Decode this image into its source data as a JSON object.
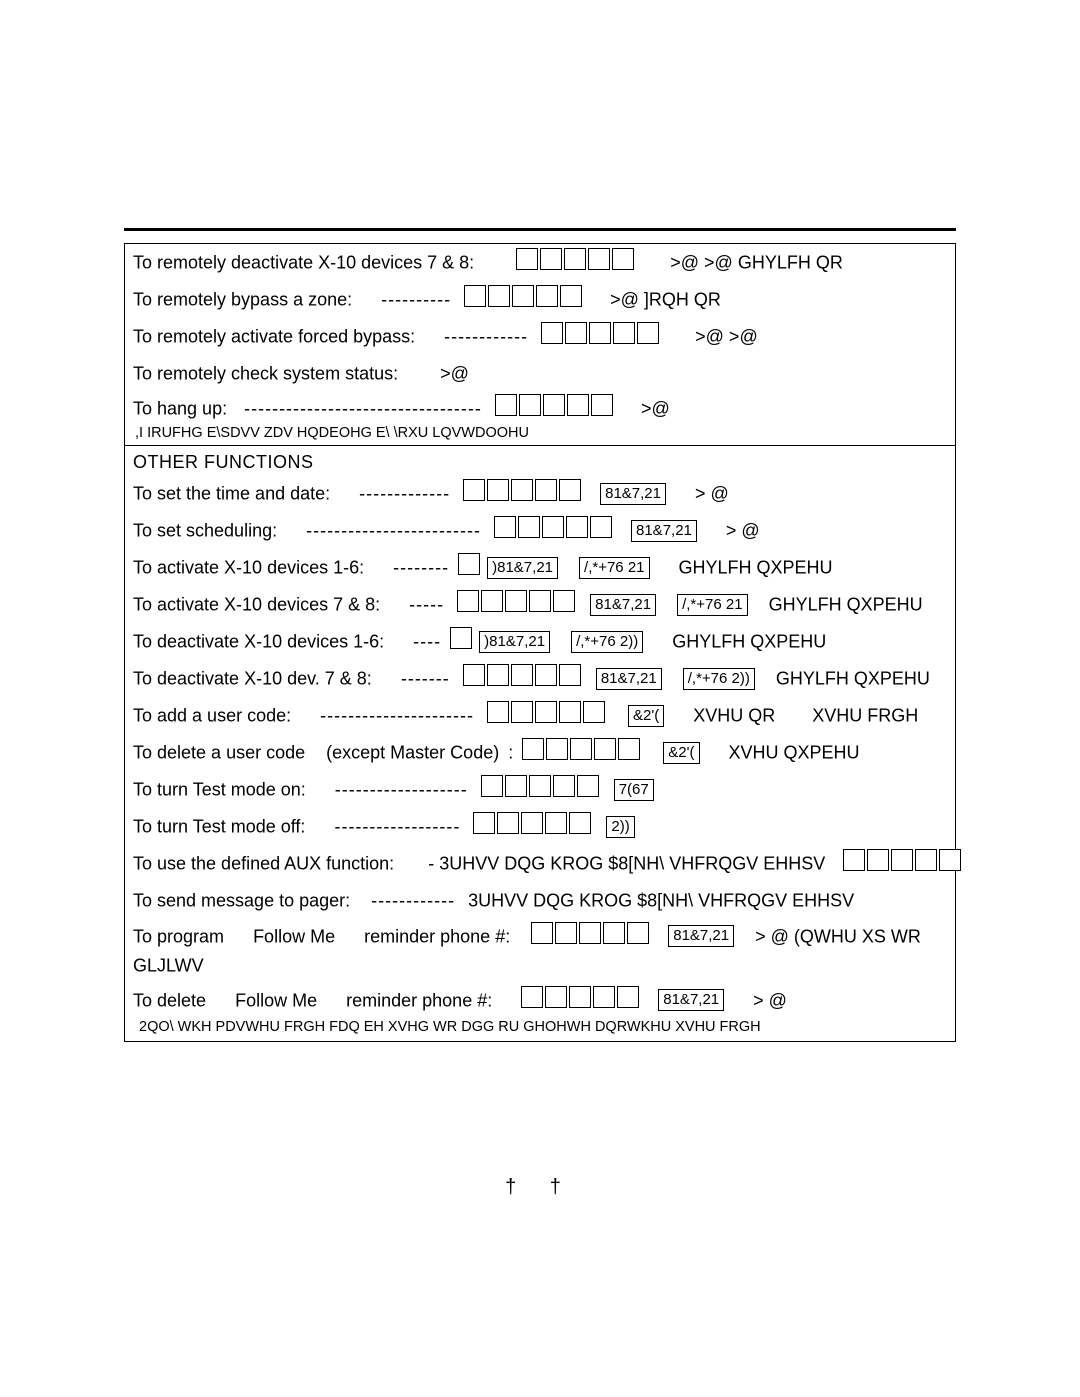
{
  "section1": {
    "r1": {
      "label": "To remotely deactivate X-10 devices 7 & 8:",
      "tail": ">@  >@  GHYLFH QR"
    },
    "r2": {
      "label": "To remotely bypass a zone:",
      "dashes": "----------",
      "tail": ">@   ]RQH QR"
    },
    "r3": {
      "label": "To remotely activate forced bypass:",
      "dashes": "------------",
      "tail": ">@  >@"
    },
    "r4": {
      "label": "To remotely check system status:",
      "tail": ">@"
    },
    "r5": {
      "label": "To hang up:",
      "dashes": "----------------------------------",
      "tail": ">@"
    },
    "note": ",I IRUFHG E\\SDVV ZDV HQDEOHG E\\ \\RXU LQVWDOOHU"
  },
  "section2": {
    "header": "OTHER FUNCTIONS",
    "r1": {
      "label": "To set the time and date:",
      "dashes": "-------------",
      "key": "81&7,21",
      "tail": ">  @"
    },
    "r2": {
      "label": "To set scheduling:",
      "dashes": "-------------------------",
      "key": "81&7,21",
      "tail": ">  @"
    },
    "r3": {
      "label": "To activate X-10 devices 1-6:",
      "dashes": "--------",
      "k1": ")81&7,21",
      "k2": "/,*+76 21",
      "tail": "GHYLFH QXPEHU"
    },
    "r4": {
      "label": "To activate X-10 devices 7 & 8:",
      "dashes": "-----",
      "k1": "81&7,21",
      "k2": "/,*+76 21",
      "tail": "GHYLFH QXPEHU"
    },
    "r5": {
      "label": "To deactivate X-10 devices 1-6:",
      "dashes": "----",
      "k1": ")81&7,21",
      "k2": "/,*+76 2))",
      "tail": "GHYLFH QXPEHU"
    },
    "r6": {
      "label": "To deactivate X-10 dev. 7 & 8:",
      "dashes": "-------",
      "k1": "81&7,21",
      "k2": "/,*+76 2))",
      "tail": "GHYLFH QXPEHU"
    },
    "r7": {
      "label": "To add a user code:",
      "dashes": "----------------------",
      "k": "&2'(",
      "t1": "XVHU QR",
      "t2": "XVHU FRGH"
    },
    "r8": {
      "label": "To delete a user code",
      "paren": "(except Master Code)",
      "colon": ":",
      "k": "&2'(",
      "tail": "XVHU QXPEHU"
    },
    "r9": {
      "label": "To turn Test mode on:",
      "dashes": "-------------------",
      "k": "7(67"
    },
    "r10": {
      "label": "To turn Test mode off:",
      "dashes": "------------------",
      "k": "2))"
    },
    "r11": {
      "label": "To use the defined AUX function:",
      "mid": "- 3UHVV DQG KROG  $8[NH\\  VHFRQGV   EHHSV",
      "aux": "$8["
    },
    "r12": {
      "label": "To send message to pager:",
      "dashes": "------------",
      "mid": "3UHVV DQG KROG  $8[NH\\  VHFRQGV   EHHSV",
      "aux": "$8["
    },
    "r13": {
      "a": "To program",
      "b": "Follow Me",
      "c": "reminder phone #:",
      "k": "81&7,21",
      "tail": ">  @  (QWHU XS WR",
      "line2": "GLJLWV"
    },
    "r14": {
      "a": "To delete",
      "b": "Follow Me",
      "c": "reminder phone #:",
      "k": "81&7,21",
      "tail": ">  @"
    },
    "note": "2QO\\ WKH PDVWHU FRGH FDQ EH XVHG WR DGG RU GHOHWH DQRWKHU XVHU FRGH"
  },
  "footer": {
    "dag": "†  †"
  }
}
